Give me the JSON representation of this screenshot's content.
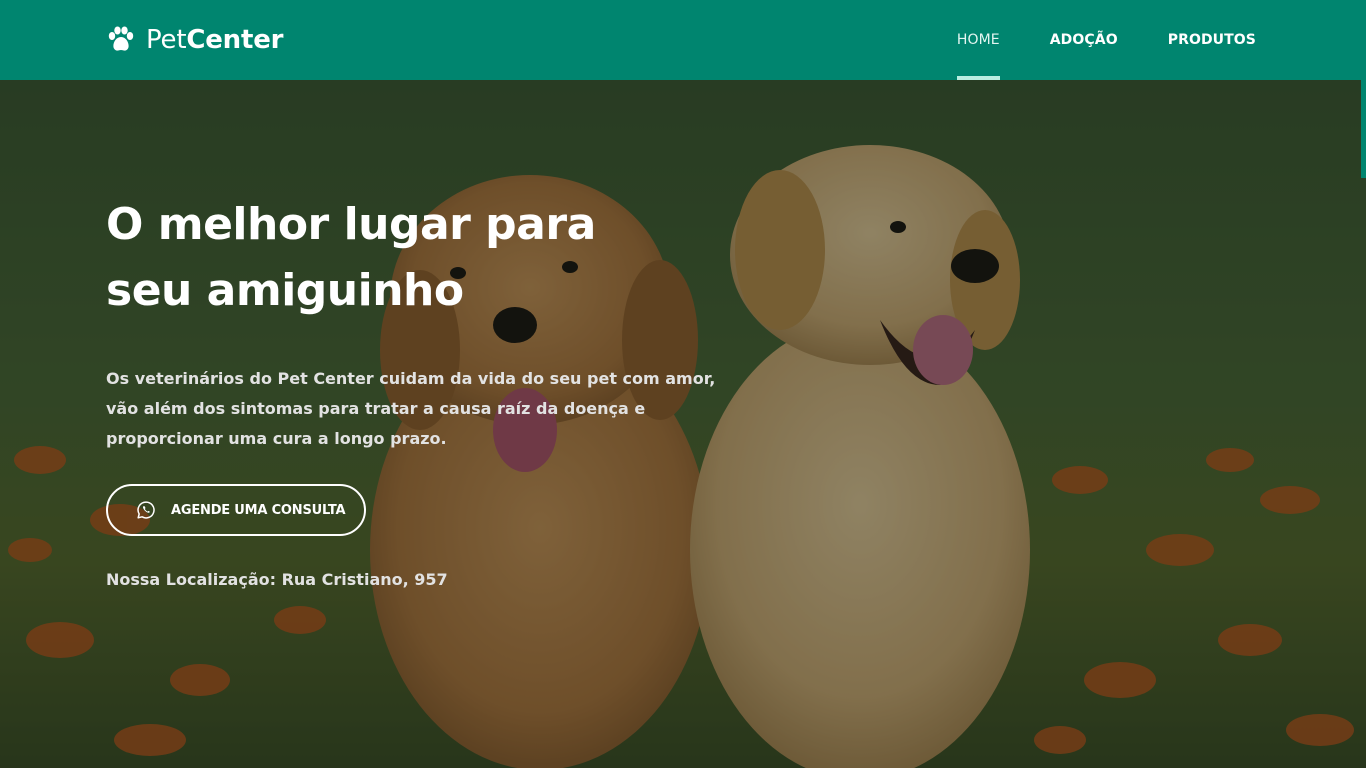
{
  "navbar": {
    "brand": {
      "part1": "Pet",
      "part2": "Center",
      "icon": "paw-icon"
    },
    "links": [
      {
        "label": "HOME",
        "active": true
      },
      {
        "label": "ADOÇÃO",
        "active": false
      },
      {
        "label": "PRODUTOS",
        "active": false
      }
    ]
  },
  "hero": {
    "title": "O melhor lugar para seu amiguinho",
    "description": "Os veterinários do Pet Center cuidam da vida do seu pet com amor, vão além dos sintomas para tratar a causa raíz da doença e proporcionar uma cura a longo prazo.",
    "cta_label": "AGENDE UMA CONSULTA",
    "cta_icon": "whatsapp-icon",
    "location": "Nossa Localização: Rua Cristiano, 957",
    "background": "photo-of-two-golden-retriever-puppies-on-grass-with-orange-flowers"
  },
  "colors": {
    "primary": "#00856f",
    "active_indicator": "#b9eee1",
    "text_light": "#e2e2e2"
  }
}
